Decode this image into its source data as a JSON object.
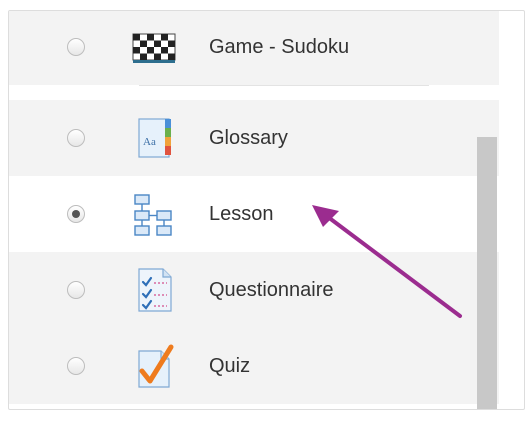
{
  "activities": [
    {
      "label": "Game - Sudoku",
      "icon": "sudoku-grid-icon",
      "selected": false
    },
    {
      "label": "Glossary",
      "icon": "glossary-book-icon",
      "selected": false
    },
    {
      "label": "Lesson",
      "icon": "lesson-flowchart-icon",
      "selected": true
    },
    {
      "label": "Questionnaire",
      "icon": "questionnaire-checklist-icon",
      "selected": false
    },
    {
      "label": "Quiz",
      "icon": "quiz-checkmark-icon",
      "selected": false
    }
  ],
  "colors": {
    "annotation_arrow": "#9b2c8f",
    "row_shade": "#f3f3f3",
    "scrollbar_thumb": "#c8c8c8"
  }
}
